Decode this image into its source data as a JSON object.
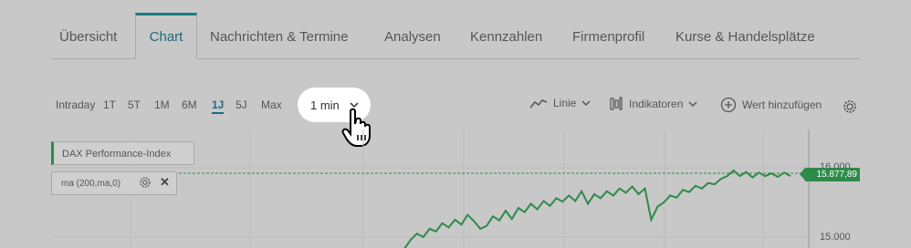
{
  "tabs": [
    "Übersicht",
    "Chart",
    "Nachrichten & Termine",
    "Analysen",
    "Kennzahlen",
    "Firmenprofil",
    "Kurse & Handelsplätze"
  ],
  "active_tab": "Chart",
  "ranges": [
    "Intraday",
    "1T",
    "5T",
    "1M",
    "6M",
    "1J",
    "5J",
    "Max"
  ],
  "active_range": "1J",
  "interval_dropdown": {
    "value": "1 min",
    "icon": "chevron-down-icon"
  },
  "chart_type_button": {
    "label": "Linie",
    "icon": "line-chart-icon"
  },
  "indicators_button": {
    "label": "Indikatoren",
    "icon": "indicators-icon"
  },
  "add_value_button": {
    "label": "Wert hinzufügen",
    "icon": "plus-circle-icon"
  },
  "settings_icon": "gear-icon",
  "legend": {
    "index_name": "DAX Performance-Index",
    "indicator": "ma (200,ma,0)"
  },
  "price_badge": "15.877,89",
  "y_axis_labels": [
    "16.000",
    "15.000"
  ],
  "colors": {
    "accent": "#1c7c84",
    "line": "#2e8a4a",
    "background": "#c8c8c8"
  },
  "chart_data": {
    "type": "line",
    "series": [
      {
        "name": "DAX Performance-Index",
        "values": [
          14700,
          14830,
          14960,
          15050,
          15000,
          15120,
          15080,
          15200,
          15140,
          15250,
          15180,
          15320,
          15230,
          15120,
          15160,
          15300,
          15240,
          15380,
          15260,
          15420,
          15360,
          15480,
          15400,
          15520,
          15450,
          15560,
          15510,
          15600,
          15520,
          15660,
          15480,
          15620,
          15560,
          15660,
          15600,
          15700,
          15640,
          15730,
          15620,
          15700,
          15250,
          15440,
          15500,
          15600,
          15570,
          15680,
          15650,
          15740,
          15700,
          15780,
          15760,
          15840,
          15880,
          15960,
          15880,
          15940,
          15860,
          15930,
          15880,
          15920,
          15870,
          15930,
          15880
        ]
      }
    ],
    "ylim": [
      14700,
      16100
    ],
    "last_value": 15877.89,
    "y_ticks": [
      16000,
      15000
    ]
  }
}
